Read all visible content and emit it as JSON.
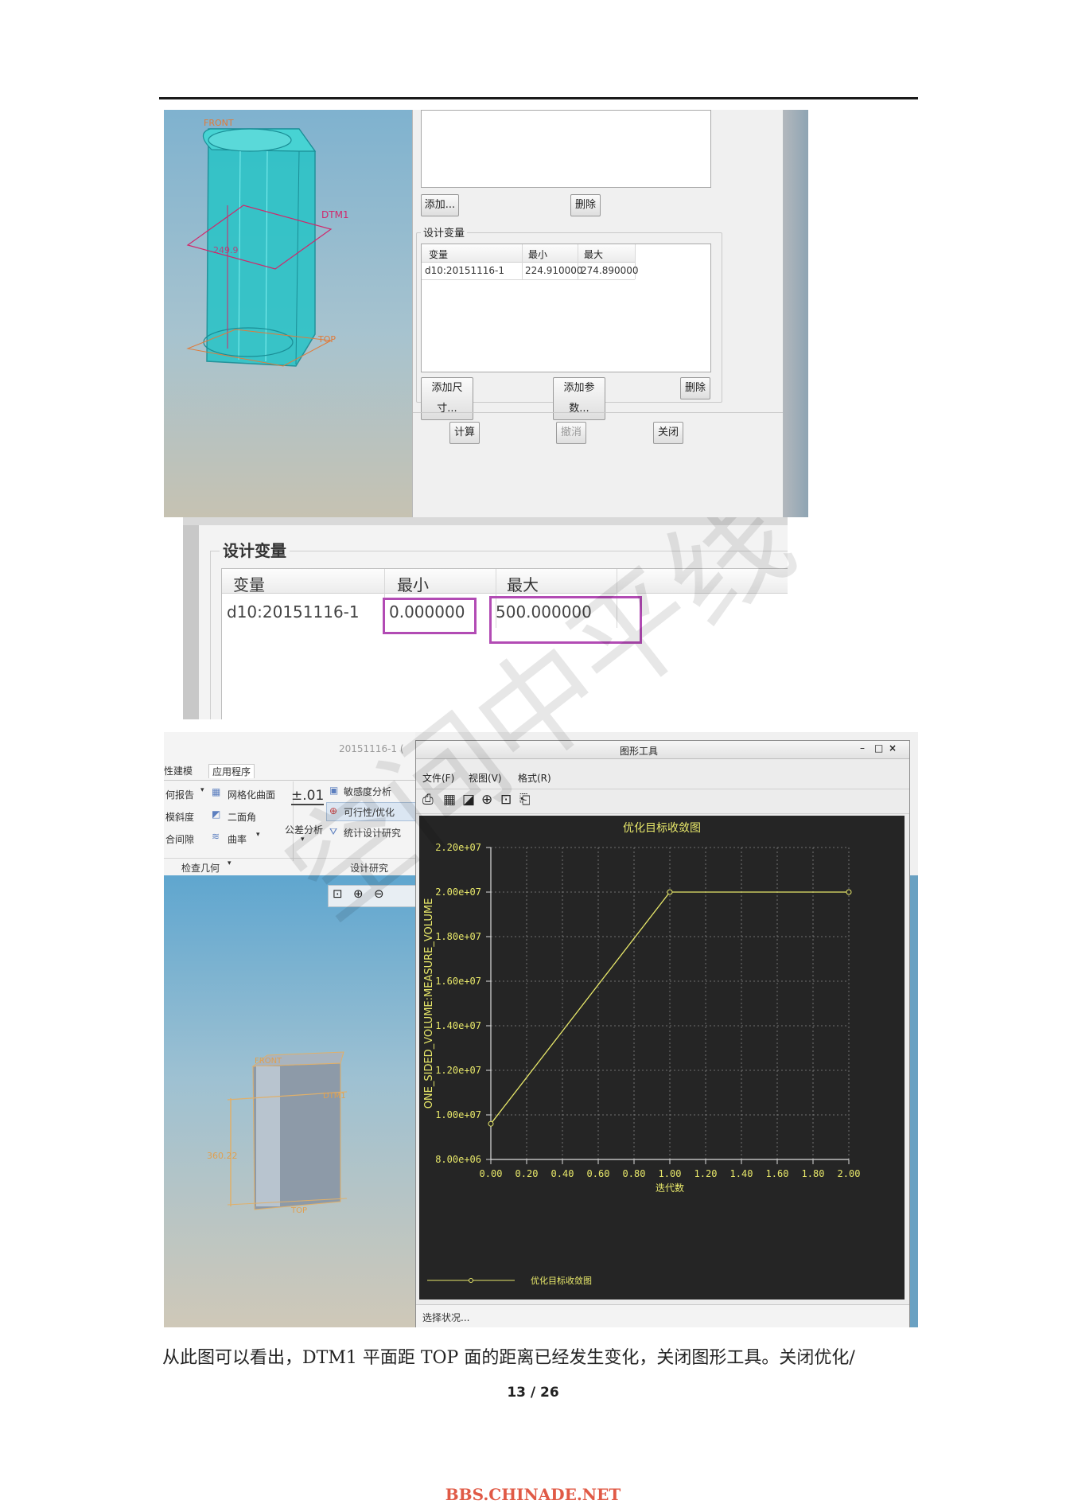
{
  "shot1": {
    "model_labels": {
      "front": "FRONT",
      "dtm1": "DTM1",
      "dim": "249.9",
      "top": "TOP"
    },
    "buttons_top": {
      "add": "添加...",
      "delete": "删除"
    },
    "design_vars_group": "设计变量",
    "table": {
      "headers": [
        "变量",
        "最小",
        "最大"
      ],
      "rows": [
        [
          "d10:20151116-1",
          "224.910000",
          "274.890000"
        ]
      ]
    },
    "buttons_mid": {
      "add_dim": "添加尺寸...",
      "add_param": "添加参数...",
      "delete": "删除"
    },
    "buttons_bottom": {
      "compute": "计算",
      "undo": "撤消",
      "close": "关闭"
    }
  },
  "shot2": {
    "group": "设计变量",
    "headers": [
      "变量",
      "最小",
      "最大"
    ],
    "row": [
      "d10:20151116-1",
      "0.000000",
      "500.000000"
    ],
    "highlight_color": "#b24bb4"
  },
  "shot3": {
    "window_title_left": "20151116-1 (",
    "ribbon_tabs": [
      "性建模",
      "应用程序"
    ],
    "ribbon_items": {
      "report": "何报告",
      "mesh": "网格化曲面",
      "draft": "模斜度",
      "dihedral": "二面角",
      "clearance": "合间隙",
      "curvature": "曲率",
      "tolerance_icon": "±.01",
      "tolerance": "公差分析",
      "sensitivity": "敏感度分析",
      "feasibility": "可行性/优化",
      "statistical": "统计设计研究",
      "group_check": "检查几何",
      "group_design": "设计研究"
    },
    "model_labels": {
      "front": "FRONT",
      "dtm1": "DTM1",
      "dim": "360.22",
      "top": "TOP"
    },
    "graph_window": {
      "title": "图形工具",
      "menu": [
        "文件(F)",
        "视图(V)",
        "格式(R)"
      ],
      "status": "选择状况..."
    }
  },
  "chart_data": {
    "type": "line",
    "title": "优化目标收敛图",
    "xlabel": "迭代数",
    "ylabel": "ONE_SIDED_VOLUME:MEASURE_VOLUME",
    "xlim": [
      0,
      2.0
    ],
    "ylim": [
      8000000,
      22000000
    ],
    "x_ticks": [
      "0.00",
      "0.20",
      "0.40",
      "0.60",
      "0.80",
      "1.00",
      "1.20",
      "1.40",
      "1.60",
      "1.80",
      "2.00"
    ],
    "y_ticks": [
      "8.00e+06",
      "1.00e+07",
      "1.20e+07",
      "1.40e+07",
      "1.60e+07",
      "1.80e+07",
      "2.00e+07",
      "2.20e+07"
    ],
    "series": [
      {
        "name": "优化目标收敛图",
        "x": [
          0,
          1,
          2
        ],
        "y": [
          9600000,
          20000000,
          20000000
        ],
        "color": "#e8e86a"
      }
    ],
    "grid": true,
    "legend": "bottom-left"
  },
  "caption": "从此图可以看出，DTM1 平面距 TOP 面的距离已经发生变化，关闭图形工具。关闭优化/",
  "page_number": "13 / 26",
  "footer": "BBS.CHINADE.NET",
  "watermark": "空间中平线"
}
